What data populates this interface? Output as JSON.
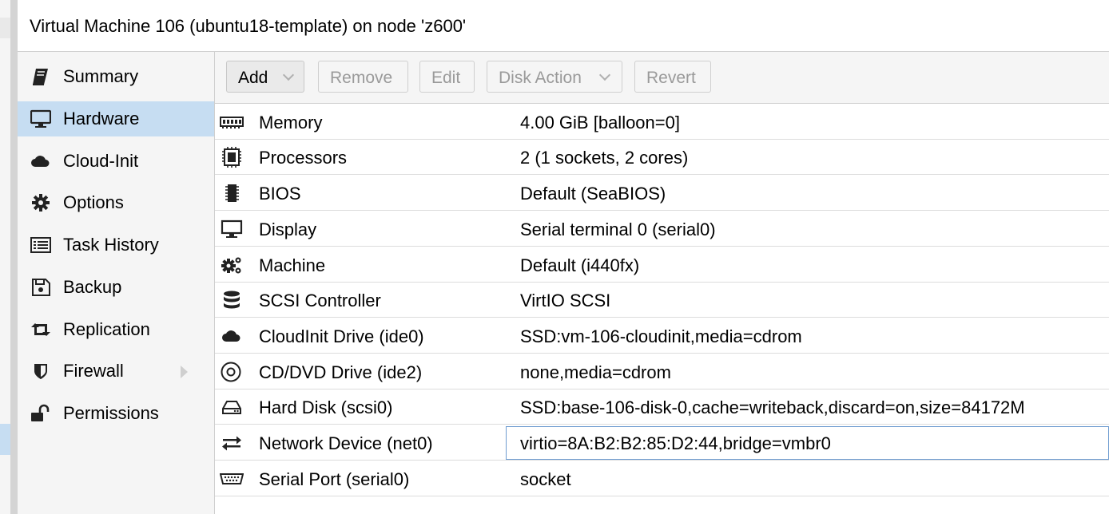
{
  "window": {
    "title": "Virtual Machine 106 (ubuntu18-template) on node 'z600'"
  },
  "sidebar": {
    "items": [
      {
        "label": "Summary",
        "icon": "book-icon"
      },
      {
        "label": "Hardware",
        "icon": "desktop-icon",
        "active": true
      },
      {
        "label": "Cloud-Init",
        "icon": "cloud-icon"
      },
      {
        "label": "Options",
        "icon": "gear-icon"
      },
      {
        "label": "Task History",
        "icon": "list-icon"
      },
      {
        "label": "Backup",
        "icon": "floppy-icon"
      },
      {
        "label": "Replication",
        "icon": "retweet-icon"
      },
      {
        "label": "Firewall",
        "icon": "shield-icon",
        "expandable": true
      },
      {
        "label": "Permissions",
        "icon": "unlock-icon"
      }
    ]
  },
  "toolbar": {
    "add": "Add",
    "remove": "Remove",
    "edit": "Edit",
    "disk_action": "Disk Action",
    "revert": "Revert"
  },
  "hardware": [
    {
      "name": "Memory",
      "value": "4.00 GiB [balloon=0]",
      "icon": "memory-icon"
    },
    {
      "name": "Processors",
      "value": "2 (1 sockets, 2 cores)",
      "icon": "cpu-icon"
    },
    {
      "name": "BIOS",
      "value": "Default (SeaBIOS)",
      "icon": "microchip-icon"
    },
    {
      "name": "Display",
      "value": "Serial terminal 0 (serial0)",
      "icon": "desktop-icon"
    },
    {
      "name": "Machine",
      "value": "Default (i440fx)",
      "icon": "cogs-icon"
    },
    {
      "name": "SCSI Controller",
      "value": "VirtIO SCSI",
      "icon": "database-icon"
    },
    {
      "name": "CloudInit Drive (ide0)",
      "value": "SSD:vm-106-cloudinit,media=cdrom",
      "icon": "cloud-icon"
    },
    {
      "name": "CD/DVD Drive (ide2)",
      "value": "none,media=cdrom",
      "icon": "cdrom-icon"
    },
    {
      "name": "Hard Disk (scsi0)",
      "value": "SSD:base-106-disk-0,cache=writeback,discard=on,size=84172M",
      "icon": "hdd-icon"
    },
    {
      "name": "Network Device (net0)",
      "value": "virtio=8A:B2:B2:85:D2:44,bridge=vmbr0",
      "icon": "exchange-icon",
      "selected": true
    },
    {
      "name": "Serial Port (serial0)",
      "value": "socket",
      "icon": "serial-port-icon"
    }
  ],
  "colors": {
    "selection": "#c6ddf2",
    "row_focus_border": "#6e9cd0"
  }
}
